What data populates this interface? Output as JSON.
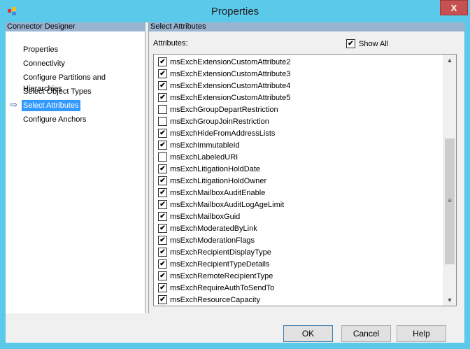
{
  "window": {
    "title": "Properties",
    "close": "X"
  },
  "left": {
    "header": "Connector Designer",
    "items": [
      {
        "label": "Properties"
      },
      {
        "label": "Connectivity"
      },
      {
        "label": "Configure Partitions and Hierarchies"
      },
      {
        "label": "Select Object Types"
      },
      {
        "label": "Select Attributes",
        "selected": true
      },
      {
        "label": "Configure Anchors"
      }
    ],
    "arrow": "⇨"
  },
  "right": {
    "header": "Select Attributes",
    "attributes_label": "Attributes:",
    "show_all": {
      "label": "Show All",
      "checked": true
    },
    "attributes": [
      {
        "name": "msExchExtensionCustomAttribute2",
        "checked": true
      },
      {
        "name": "msExchExtensionCustomAttribute3",
        "checked": true
      },
      {
        "name": "msExchExtensionCustomAttribute4",
        "checked": true
      },
      {
        "name": "msExchExtensionCustomAttribute5",
        "checked": true
      },
      {
        "name": "msExchGroupDepartRestriction",
        "checked": false
      },
      {
        "name": "msExchGroupJoinRestriction",
        "checked": false
      },
      {
        "name": "msExchHideFromAddressLists",
        "checked": true
      },
      {
        "name": "msExchImmutableId",
        "checked": true
      },
      {
        "name": "msExchLabeledURI",
        "checked": false
      },
      {
        "name": "msExchLitigationHoldDate",
        "checked": true
      },
      {
        "name": "msExchLitigationHoldOwner",
        "checked": true
      },
      {
        "name": "msExchMailboxAuditEnable",
        "checked": true
      },
      {
        "name": "msExchMailboxAuditLogAgeLimit",
        "checked": true
      },
      {
        "name": "msExchMailboxGuid",
        "checked": true
      },
      {
        "name": "msExchModeratedByLink",
        "checked": true
      },
      {
        "name": "msExchModerationFlags",
        "checked": true
      },
      {
        "name": "msExchRecipientDisplayType",
        "checked": true
      },
      {
        "name": "msExchRecipientTypeDetails",
        "checked": true
      },
      {
        "name": "msExchRemoteRecipientType",
        "checked": true
      },
      {
        "name": "msExchRequireAuthToSendTo",
        "checked": true
      },
      {
        "name": "msExchResourceCapacity",
        "checked": true
      }
    ]
  },
  "buttons": {
    "ok": "OK",
    "cancel": "Cancel",
    "help": "Help"
  }
}
